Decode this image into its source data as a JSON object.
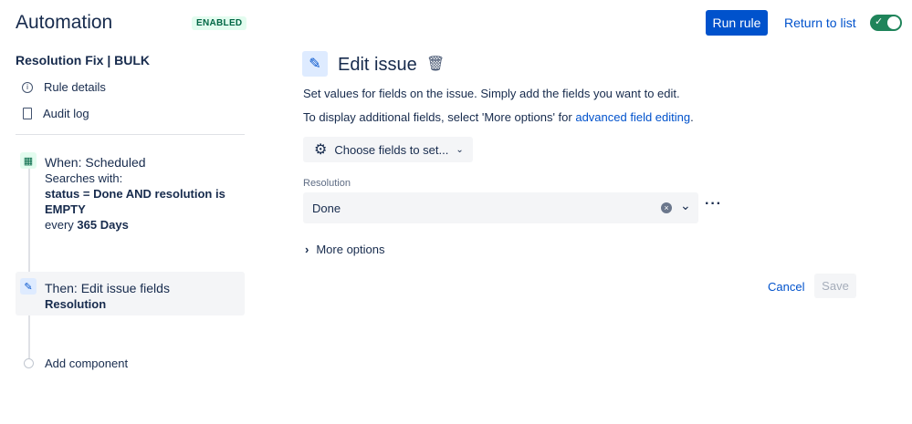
{
  "header": {
    "title": "Automation",
    "status_badge": "ENABLED",
    "run_rule": "Run rule",
    "return_to_list": "Return to list",
    "enabled": true
  },
  "sidebar": {
    "rule_name": "Resolution Fix | BULK",
    "items": [
      {
        "label": "Rule details",
        "icon": "info-icon"
      },
      {
        "label": "Audit log",
        "icon": "document-icon"
      }
    ],
    "trigger": {
      "title": "When: Scheduled",
      "line1": "Searches with:",
      "query": "status = Done AND resolution is EMPTY",
      "every_prefix": "every",
      "every_value": "365 Days"
    },
    "action": {
      "title": "Then: Edit issue fields",
      "detail": "Resolution"
    },
    "add_component": "Add component"
  },
  "main": {
    "title": "Edit issue",
    "desc1": "Set values for fields on the issue. Simply add the fields you want to edit.",
    "desc2_prefix": "To display additional fields, select 'More options' for ",
    "desc2_link": "advanced field editing",
    "desc2_suffix": ".",
    "choose_fields": "Choose fields to set...",
    "field_label": "Resolution",
    "field_value": "Done",
    "more_options": "More options",
    "cancel": "Cancel",
    "save": "Save"
  },
  "colors": {
    "primary": "#0052cc",
    "success": "#1f845a"
  }
}
